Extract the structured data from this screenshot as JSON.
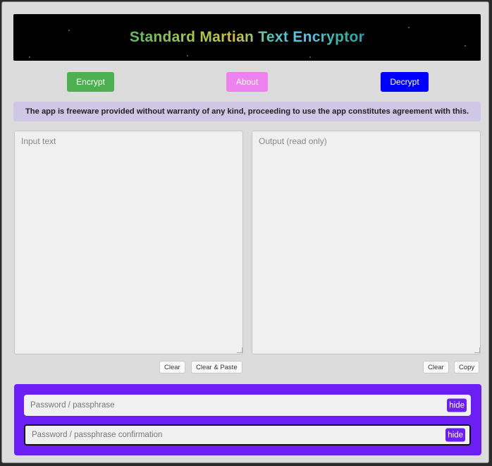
{
  "header": {
    "title": "Standard Martian Text Encryptor"
  },
  "nav": {
    "encrypt_label": "Encrypt",
    "about_label": "About",
    "decrypt_label": "Decrypt"
  },
  "notice": {
    "text": "The app is freeware provided without warranty of any kind, proceeding to use the app constitutes agreement with this."
  },
  "input": {
    "placeholder": "Input text",
    "clear_label": "Clear",
    "clear_paste_label": "Clear & Paste"
  },
  "output": {
    "placeholder": "Output (read only)",
    "clear_label": "Clear",
    "copy_label": "Copy"
  },
  "password": {
    "placeholder": "Password / passphrase",
    "confirm_placeholder": "Password / passphrase confirmation",
    "hide_label": "hide",
    "confirm_hide_label": "hide"
  },
  "colors": {
    "encrypt": "#4caf50",
    "about": "#ee82ee",
    "decrypt": "#0000ff",
    "panel": "#6c1ff4",
    "notice_bg": "#cfc7e6"
  }
}
